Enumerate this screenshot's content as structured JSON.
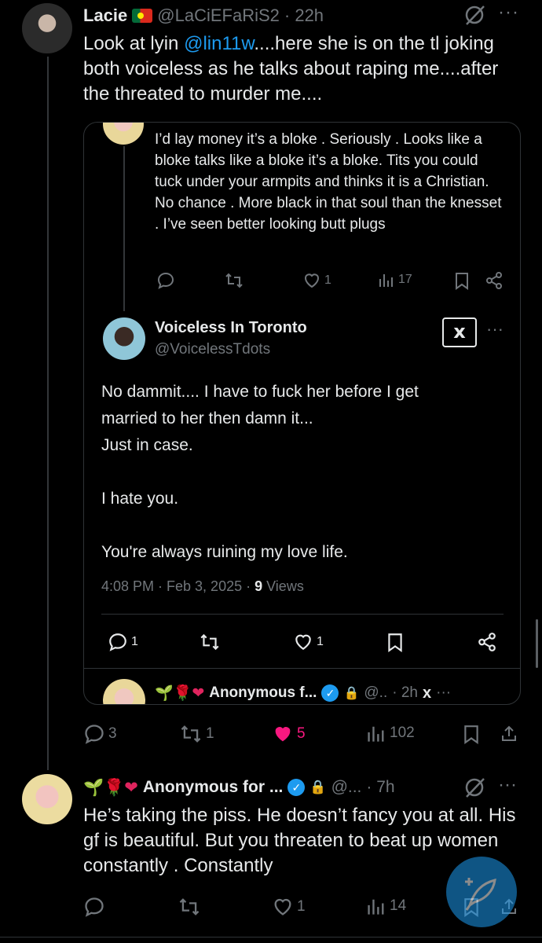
{
  "main_post": {
    "display_name": "Lacie",
    "flag_icon": "portugal-flag-icon",
    "handle": "@LaCiEFaRiS2",
    "time": "· 22h",
    "text_prefix": "Look at lyin ",
    "mention": "@lin11w",
    "text_suffix": "....here she is on the tl joking both voiceless as he talks about raping me....after the threated to murder me....",
    "actions": {
      "replies": "3",
      "reposts": "1",
      "likes": "5",
      "views": "102"
    }
  },
  "embed": {
    "quoted_reply": {
      "text": "I’d lay money it’s a bloke . Seriously . Looks like a bloke talks like a bloke it’s a bloke. Tits you could tuck under your armpits and thinks it is a Christian. No chance . More black in that soul than the knesset . I’ve seen better looking butt plugs",
      "actions": {
        "replies": "",
        "reposts": "",
        "likes": "1",
        "views": "17"
      }
    },
    "focused_post": {
      "display_name": "Voiceless In Toronto",
      "handle": "@VoicelessTdots",
      "xai_label": "x",
      "line1": "No dammit.... I have to fuck her before I get",
      "line2": "married to her then damn it...",
      "line3": "Just in case.",
      "line4": "I hate you.",
      "line5": "You're always ruining my love life.",
      "timestamp": "4:08 PM · Feb 3, 2025 · ",
      "views_count": "9",
      "views_label": " Views",
      "actions": {
        "replies": "1",
        "reposts": "",
        "likes": "1"
      }
    },
    "next_reply": {
      "emojis": "🌱🌹❤",
      "display_name": "Anonymous f...",
      "handle": "@..",
      "time": "· 2h"
    }
  },
  "reply_post": {
    "emojis": "🌱🌹❤",
    "display_name": "Anonymous for ...",
    "handle": "@...",
    "time": "· 7h",
    "text": "He’s taking the piss. He doesn’t fancy you at all. His gf is beautiful. But you threaten to beat up women constantly . Constantly",
    "actions": {
      "replies": "",
      "reposts": "",
      "likes": "1",
      "views": "14"
    }
  },
  "colors": {
    "accent": "#1d9bf0",
    "like_active": "#f91880",
    "muted": "#71767b",
    "text": "#e7e9ea"
  }
}
